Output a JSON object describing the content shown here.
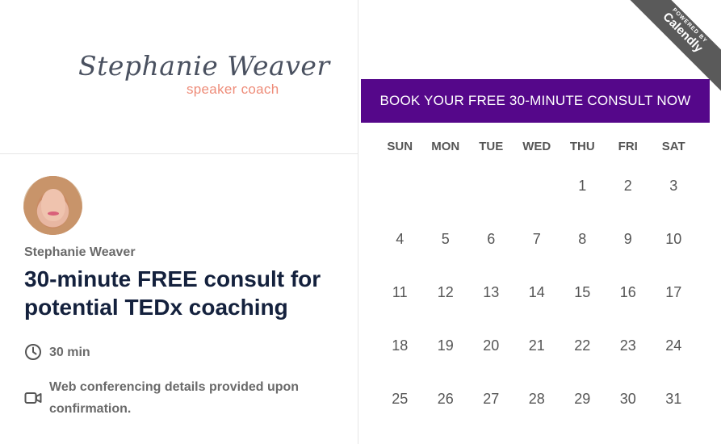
{
  "logo": {
    "name": "Stephanie Weaver",
    "tagline": "speaker coach"
  },
  "organizer": {
    "name": "Stephanie Weaver",
    "avatar": "profile-photo"
  },
  "event": {
    "title": "30-minute FREE consult for potential TEDx coaching",
    "duration": "30 min",
    "duration_icon": "clock-icon",
    "location": "Web conferencing details provided upon confirmation.",
    "location_icon": "video-camera-icon"
  },
  "badge": {
    "line1": "POWERED BY",
    "line2": "Calendly"
  },
  "booking": {
    "banner": "BOOK YOUR FREE 30-MINUTE CONSULT NOW"
  },
  "calendar": {
    "weekdays": [
      "SUN",
      "MON",
      "TUE",
      "WED",
      "THU",
      "FRI",
      "SAT"
    ],
    "days": [
      "",
      "",
      "",
      "",
      "1",
      "2",
      "3",
      "4",
      "5",
      "6",
      "7",
      "8",
      "9",
      "10",
      "11",
      "12",
      "13",
      "14",
      "15",
      "16",
      "17",
      "18",
      "19",
      "20",
      "21",
      "22",
      "23",
      "24",
      "25",
      "26",
      "27",
      "28",
      "29",
      "30",
      "31"
    ]
  },
  "colors": {
    "banner": "#55078a",
    "title": "#14213d",
    "logo_tagline": "#ee8c79",
    "badge": "#5a5a5a"
  }
}
